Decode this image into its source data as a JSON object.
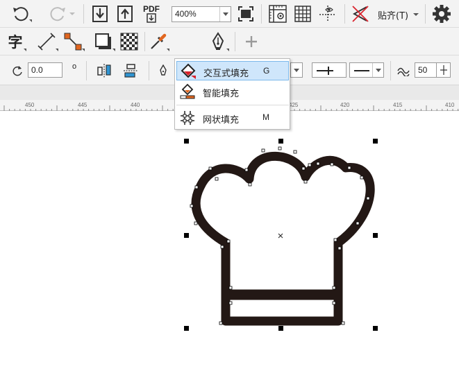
{
  "toolbar": {
    "zoom_value": "400%",
    "snap_label": "贴齐(T)",
    "text_tool_glyph": "字",
    "pdf_label": "PDF"
  },
  "property_bar": {
    "rotation_value": "0.0",
    "degree_symbol": "o",
    "size_value": "50"
  },
  "ruler": {
    "labels": [
      "450",
      "445",
      "440",
      "425",
      "420",
      "415",
      "410"
    ]
  },
  "fill_menu": {
    "items": [
      {
        "label": "交互式填充",
        "shortcut": "G"
      },
      {
        "label": "智能填充",
        "shortcut": ""
      },
      {
        "label": "网状填充",
        "shortcut": "M"
      }
    ]
  },
  "colors": {
    "toolbar_bg": "#f3f3f3",
    "menu_highlight": "#cfe6fb",
    "tool_highlight_border": "#e94b5a",
    "shape_fill": "#231815",
    "accent_orange": "#e1661f",
    "accent_red": "#d9232d"
  }
}
